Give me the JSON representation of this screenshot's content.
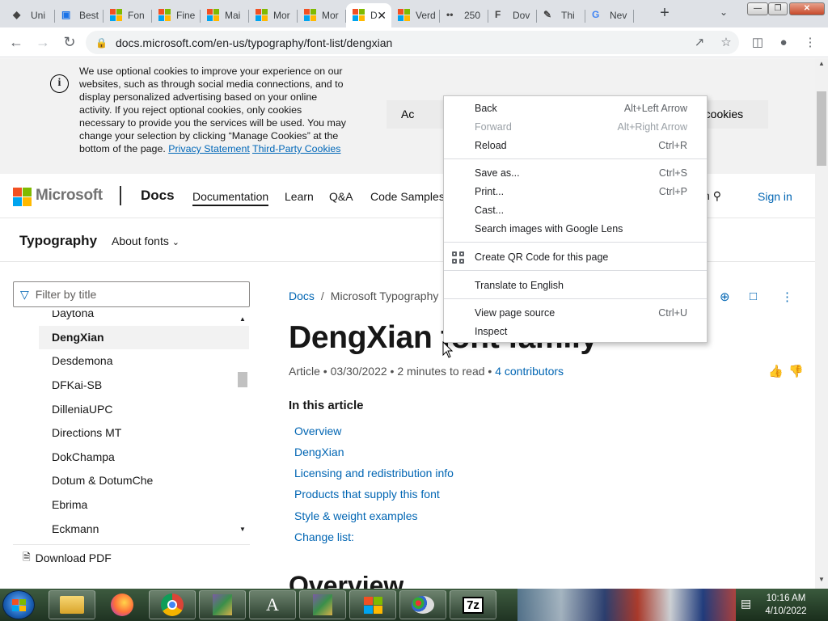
{
  "browser": {
    "tabs": [
      {
        "label": "Uni",
        "icon": "unity-icon"
      },
      {
        "label": "Best",
        "icon": "font-site-icon"
      },
      {
        "label": "Fon",
        "icon": "microsoft-icon"
      },
      {
        "label": "Fine",
        "icon": "microsoft-icon"
      },
      {
        "label": "Mai",
        "icon": "microsoft-icon"
      },
      {
        "label": "Mor",
        "icon": "microsoft-icon"
      },
      {
        "label": "Mor",
        "icon": "microsoft-icon"
      },
      {
        "label": "D",
        "icon": "microsoft-icon",
        "active": true
      },
      {
        "label": "Verd",
        "icon": "microsoft-icon"
      },
      {
        "label": "250",
        "icon": "dots-icon"
      },
      {
        "label": "Dov",
        "icon": "f-icon"
      },
      {
        "label": "Thi",
        "icon": "pen-icon"
      },
      {
        "label": "Nev",
        "icon": "google-icon"
      }
    ],
    "new_tab": "+",
    "url": "docs.microsoft.com/en-us/typography/font-list/dengxian"
  },
  "cookie_banner": {
    "text": "We use optional cookies to improve your experience on our websites, such as through social media connections, and to display personalized advertising based on your online activity. If you reject optional cookies, only cookies necessary to provide you the services will be used. You may change your selection by clicking “Manage Cookies” at the bottom of the page.",
    "privacy_link": "Privacy Statement",
    "third_party_link": "Third-Party Cookies",
    "accept_label": "Ac",
    "manage_label": "e cookies"
  },
  "header": {
    "brand": "Microsoft",
    "product": "Docs",
    "nav": [
      "Documentation",
      "Learn",
      "Q&A",
      "Code Samples"
    ],
    "search_partial": "h",
    "signin": "Sign in"
  },
  "subheader": {
    "title": "Typography",
    "about": "About fonts"
  },
  "toc": {
    "filter_placeholder": "Filter by title",
    "items": [
      "Daytona",
      "DengXian",
      "Desdemona",
      "DFKai-SB",
      "DilleniaUPC",
      "Directions MT",
      "DokChampa",
      "Dotum & DotumChe",
      "Ebrima",
      "Eckmann"
    ],
    "selected": "DengXian",
    "download_pdf": "Download PDF"
  },
  "article": {
    "breadcrumb": [
      "Docs",
      "Microsoft Typography"
    ],
    "title": "DengXian font family",
    "meta_type": "Article",
    "meta_date": "03/30/2022",
    "meta_read": "2 minutes to read",
    "meta_contributors": "4 contributors",
    "in_this_article": "In this article",
    "links": [
      "Overview",
      "DengXian",
      "Licensing and redistribution info",
      "Products that supply this font",
      "Style & weight examples",
      "Change list:"
    ],
    "next_heading": "Overview"
  },
  "context_menu": {
    "groups": [
      [
        {
          "label": "Back",
          "shortcut": "Alt+Left Arrow",
          "disabled": false
        },
        {
          "label": "Forward",
          "shortcut": "Alt+Right Arrow",
          "disabled": true
        },
        {
          "label": "Reload",
          "shortcut": "Ctrl+R",
          "disabled": false
        }
      ],
      [
        {
          "label": "Save as...",
          "shortcut": "Ctrl+S",
          "disabled": false
        },
        {
          "label": "Print...",
          "shortcut": "Ctrl+P",
          "disabled": false
        },
        {
          "label": "Cast...",
          "shortcut": "",
          "disabled": false
        },
        {
          "label": "Search images with Google Lens",
          "shortcut": "",
          "disabled": false
        }
      ],
      [
        {
          "label": "Create QR Code for this page",
          "shortcut": "",
          "disabled": false,
          "icon": "qr-code-icon"
        }
      ],
      [
        {
          "label": "Translate to English",
          "shortcut": "",
          "disabled": false
        }
      ],
      [
        {
          "label": "View page source",
          "shortcut": "Ctrl+U",
          "disabled": false
        },
        {
          "label": "Inspect",
          "shortcut": "",
          "disabled": false
        }
      ]
    ]
  },
  "taskbar": {
    "apps": [
      "file-explorer-icon",
      "firefox-icon",
      "chrome-icon",
      "archive-icon",
      "font-tool-icon",
      "archive-icon",
      "windows-icon",
      "paint-icon",
      "7zip-icon"
    ],
    "app_7z_label": "7z",
    "time": "10:16 AM",
    "date": "4/10/2022"
  },
  "colors": {
    "link": "#0065b3",
    "ms_red": "#f25022",
    "ms_green": "#7fba00",
    "ms_blue": "#00a4ef",
    "ms_yellow": "#ffb900"
  }
}
